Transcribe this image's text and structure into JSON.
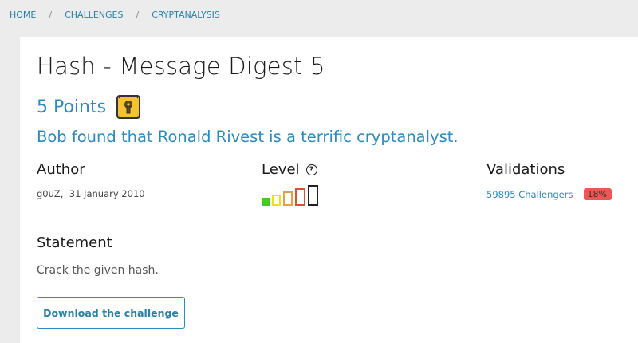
{
  "breadcrumb": {
    "home": "HOME",
    "challenges": "CHALLENGES",
    "category": "CRYPTANALYSIS",
    "separator": "/"
  },
  "challenge": {
    "title": "Hash - Message Digest 5",
    "points": "5 Points",
    "points_icon": "padlock-icon",
    "subtitle": "Bob found that Ronald Rivest is a terrific cryptanalyst."
  },
  "author": {
    "heading": "Author",
    "name": "g0uZ,",
    "date": "31 January 2010"
  },
  "level": {
    "heading": "Level",
    "help_icon": "?",
    "current": 1,
    "max": 5,
    "colors": [
      "#44cc22",
      "#e8e020",
      "#e8a040",
      "#e05030",
      "#222222"
    ]
  },
  "validations": {
    "heading": "Validations",
    "challengers": "59895 Challengers",
    "percent": "18%",
    "badge_color": "#ee5555"
  },
  "statement": {
    "heading": "Statement",
    "text": "Crack the given hash."
  },
  "actions": {
    "download": "Download the challenge"
  },
  "colors": {
    "accent": "#2b8bc1",
    "background": "#ececec",
    "panel": "#ffffff"
  }
}
